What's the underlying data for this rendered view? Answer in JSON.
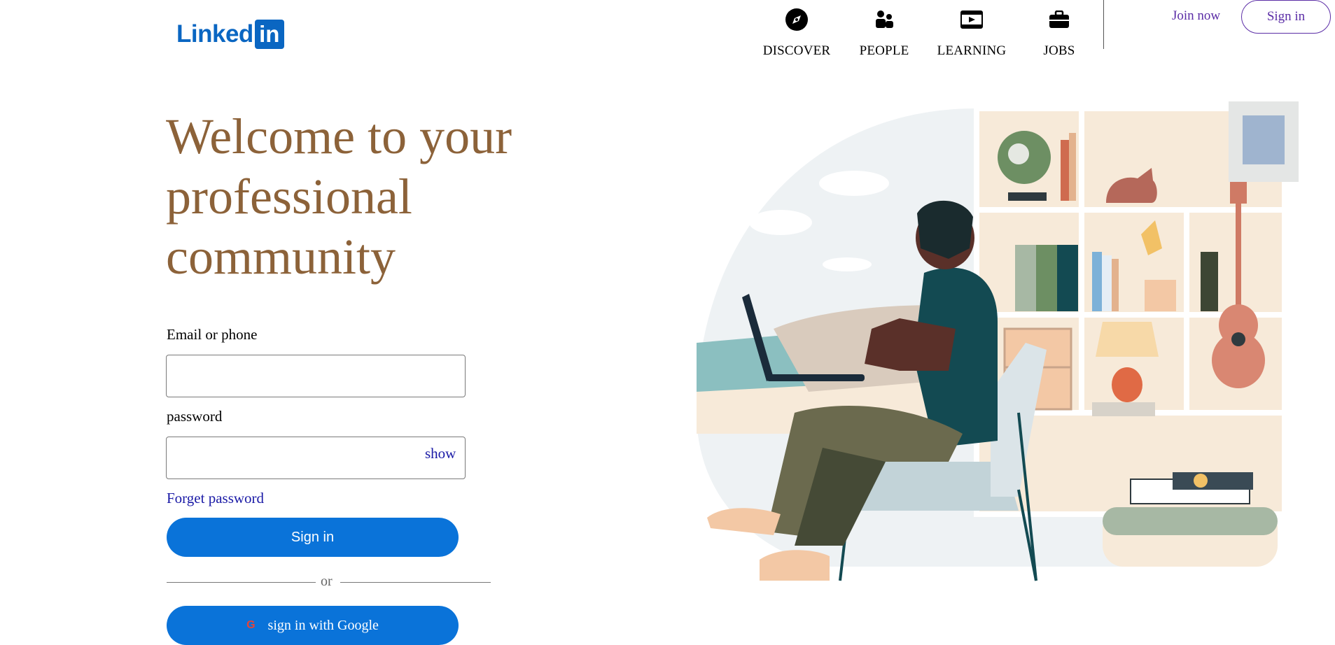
{
  "brand": {
    "logo_text": "Linked",
    "logo_box": "in"
  },
  "nav": {
    "items": [
      {
        "label": "DISCOVER",
        "icon": "compass-icon"
      },
      {
        "label": "PEOPLE",
        "icon": "people-icon"
      },
      {
        "label": "LEARNING",
        "icon": "video-play-icon"
      },
      {
        "label": "JOBS",
        "icon": "briefcase-icon"
      }
    ],
    "join_label": "Join now",
    "signin_label": "Sign in"
  },
  "hero": {
    "title": "Welcome to your professional community"
  },
  "form": {
    "email_label": "Email or phone",
    "email_value": "",
    "password_label": "password",
    "password_value": "",
    "show_label": "show",
    "forget_label": "Forget password",
    "signin_label": "Sign in",
    "or_label": "or",
    "google_icon_text": "G",
    "google_label": "sign in with Google"
  },
  "colors": {
    "brand_blue": "#0a66c2",
    "button_blue": "#0a73d9",
    "title_brown": "#8c6239",
    "link_blue": "#1a1aa6",
    "purple": "#5b2da6"
  }
}
